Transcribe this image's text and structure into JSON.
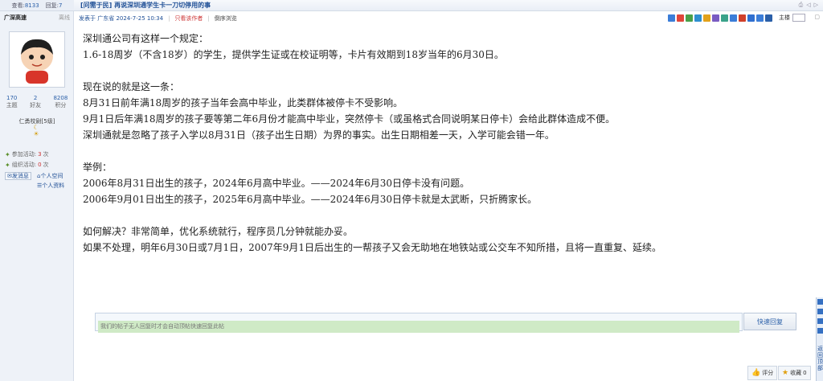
{
  "stats": {
    "views_label": "查看:",
    "views": "8133",
    "replies_label": "回复:",
    "replies": "7"
  },
  "thread": {
    "title": "[问需于民] 再说深圳通学生卡一刀切停用的事"
  },
  "user": {
    "name": "广深高速",
    "status": "离线",
    "counts": [
      {
        "value": "170",
        "label": "主题"
      },
      {
        "value": "2",
        "label": "好友"
      },
      {
        "value": "8208",
        "label": "积分"
      }
    ],
    "rank": "仁勇校尉[5级]",
    "activities": [
      {
        "label": "参加活动:",
        "count": "3",
        "unit": "次"
      },
      {
        "label": "组织活动:",
        "count": "0",
        "unit": "次"
      }
    ],
    "send_message": "发消息",
    "space_link": "个人空间",
    "profile_link": "个人资料"
  },
  "post": {
    "meta_posted": "发表于 广东省 2024-7-25 10:34",
    "meta_only_author": "只看该作者",
    "meta_browse": "倒序浏览",
    "floor_label": "主楼",
    "lines": [
      "深圳通公司有这样一个规定：",
      "1.6-18周岁（不含18岁）的学生，提供学生证或在校证明等，卡片有效期到18岁当年的6月30日。",
      "",
      "现在说的就是这一条：",
      "8月31日前年满18周岁的孩子当年会高中毕业，此类群体被停卡不受影响。",
      "9月1日后年满18周岁的孩子要等第二年6月份才能高中毕业，突然停卡（或虽格式合同说明某日停卡）会给此群体造成不便。",
      "深圳通就是忽略了孩子入学以8月31日（孩子出生日期）为界的事实。出生日期相差一天，入学可能会错一年。",
      "",
      "举例：",
      "2006年8月31日出生的孩子，2024年6月高中毕业。——2024年6月30日停卡没有问题。",
      "2006年9月01日出生的孩子，2025年6月高中毕业。——2024年6月30日停卡就是太武断，只折腾家长。",
      "",
      "如何解决？非常简单，优化系统就行，程序员几分钟就能办妥。",
      "如果不处理，明年6月30日或7月1日，2007年9月1日后出生的一帮孩子又会无助地在地铁站或公交车不知所措，且将一直重复、延续。"
    ]
  },
  "reply": {
    "placeholder": "我们的帖子无人回复时才会自动顶帖快速回复此帖",
    "button": "快速回复"
  },
  "actions": {
    "rate": "评分",
    "favorite": "收藏",
    "favorite_count": "0"
  },
  "side_tab": {
    "text": "返回顶部"
  },
  "toolbar_colors": [
    "#3b7dd8",
    "#e0453a",
    "#4aa04a",
    "#2f8fd0",
    "#e2a21b",
    "#7a5cc2",
    "#3aa38a",
    "#3b7dd8",
    "#d0402a",
    "#2f6fd0",
    "#3b7dd8",
    "#2a5fa8"
  ]
}
